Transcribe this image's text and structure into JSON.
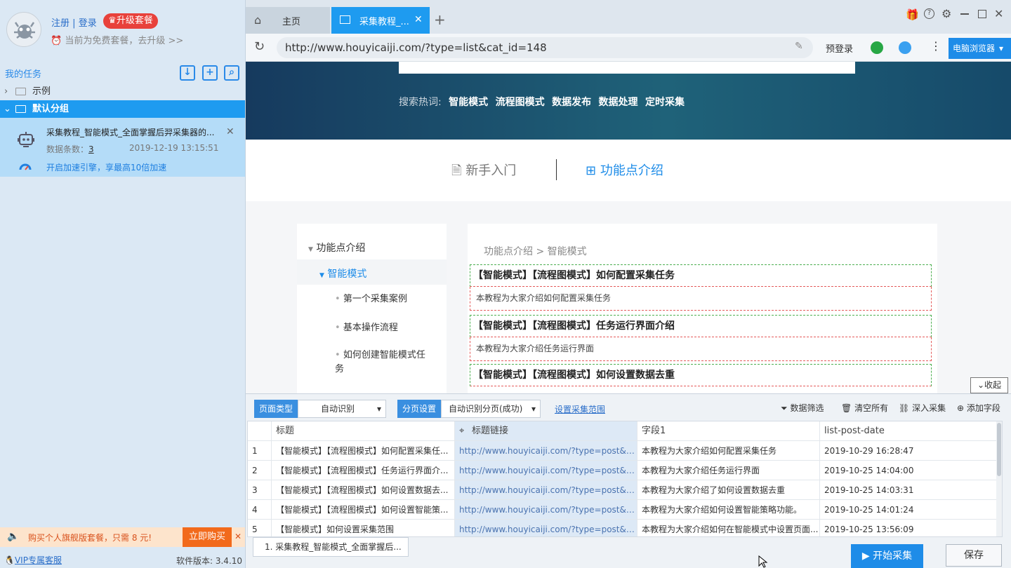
{
  "account": {
    "register": "注册",
    "sep": "|",
    "login": "登录",
    "upgrade": "升级套餐",
    "plan_note": "当前为免费套餐，去升级 >>"
  },
  "tasks": {
    "title": "我的任务",
    "groups": [
      {
        "label": "示例"
      },
      {
        "label": "默认分组"
      }
    ],
    "task": {
      "name": "采集教程_智能模式_全面掌握后羿采集器的...",
      "count_label": "数据条数：",
      "count": "3",
      "date": "2019-12-19 13:15:51",
      "accel": "开启加速引擎，享最高10倍加速"
    }
  },
  "promo": {
    "text": "购买个人旗舰版套餐，只需 8 元!",
    "buy": "立即购买"
  },
  "footer": {
    "vip": "VIP专属客服",
    "version": "软件版本: 3.4.10"
  },
  "browser": {
    "tabs": [
      {
        "label": "主页"
      },
      {
        "label": "采集教程_..."
      }
    ],
    "url": "http://www.houyicaiji.com/?type=list&cat_id=148",
    "prelogin": "预登录",
    "browser_btn": "电脑浏览器"
  },
  "site": {
    "hot_label": "搜索热词:",
    "hot_words": [
      "智能模式",
      "流程图模式",
      "数据发布",
      "数据处理",
      "定时采集"
    ],
    "nav": [
      "新手入门",
      "功能点介绍"
    ],
    "sidebar": [
      "功能点介绍",
      "智能模式",
      "第一个采集案例",
      "基本操作流程",
      "如何创建智能模式任务"
    ],
    "breadcrumb": "功能点介绍 > 智能模式",
    "articles": [
      {
        "title": "【智能模式】【流程图模式】如何配置采集任务",
        "desc": "本教程为大家介绍如何配置采集任务"
      },
      {
        "title": "【智能模式】【流程图模式】任务运行界面介绍",
        "desc": "本教程为大家介绍任务运行界面"
      },
      {
        "title": "【智能模式】【流程图模式】如何设置数据去重",
        "desc": ""
      }
    ],
    "collapse": "收起"
  },
  "panel": {
    "page_type_label": "页面类型",
    "page_type_value": "自动识别",
    "paging_label": "分页设置",
    "paging_value": "自动识别分页(成功)",
    "range_link": "设置采集范围",
    "tools": [
      "数据筛选",
      "清空所有",
      "深入采集",
      "添加字段"
    ],
    "columns": [
      "",
      "标题",
      "标题链接",
      "字段1",
      "list-post-date"
    ],
    "rows": [
      [
        "1",
        "【智能模式】【流程图模式】如何配置采集任...",
        "http://www.houyicaiji.com/?type=post&pid=7...",
        "本教程为大家介绍如何配置采集任务",
        "2019-10-29 16:28:47"
      ],
      [
        "2",
        "【智能模式】【流程图模式】任务运行界面介...",
        "http://www.houyicaiji.com/?type=post&pid=7...",
        "本教程为大家介绍任务运行界面",
        "2019-10-25 14:04:00"
      ],
      [
        "3",
        "【智能模式】【流程图模式】如何设置数据去...",
        "http://www.houyicaiji.com/?type=post&pid=7...",
        "本教程为大家介绍了如何设置数据去重",
        "2019-10-25 14:03:31"
      ],
      [
        "4",
        "【智能模式】【流程图模式】如何设置智能策...",
        "http://www.houyicaiji.com/?type=post&pid=7...",
        "本教程为大家介绍如何设置智能策略功能。",
        "2019-10-25 14:01:24"
      ],
      [
        "5",
        "【智能模式】如何设置采集范围",
        "http://www.houyicaiji.com/?type=post&pid=7...",
        "本教程为大家介绍如何在智能模式中设置页面...",
        "2019-10-25 13:56:09"
      ]
    ],
    "page_tab": "1. 采集教程_智能模式_全面掌握后...",
    "start": "开始采集",
    "save": "保存"
  }
}
